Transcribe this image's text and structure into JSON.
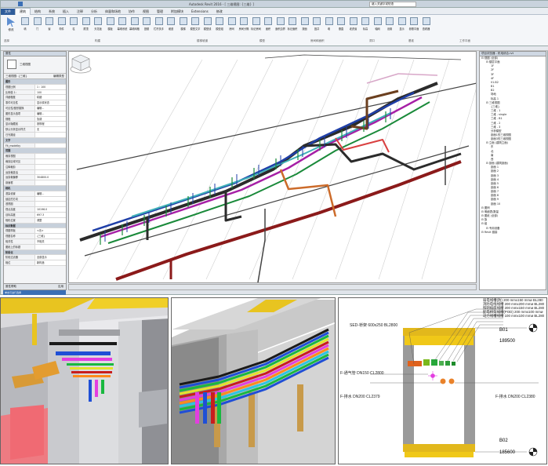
{
  "window": {
    "title": "Autodesk Revit 2016 - [ 三维视图: {三维} ]",
    "search_placeholder": "键入关键字或短语"
  },
  "ribbon": {
    "tabs": [
      "文件",
      "建筑",
      "结构",
      "系统",
      "插入",
      "注释",
      "分析",
      "体量和场地",
      "协作",
      "视图",
      "管理",
      "附加模块",
      "Extensions",
      "修改"
    ],
    "active_tab": "建筑",
    "modify_label": "修改",
    "buttons": [
      "墙",
      "门",
      "窗",
      "构件",
      "柱",
      "屋顶",
      "天花板",
      "楼板",
      "幕墙系统",
      "幕墙网格",
      "竖梃",
      "栏杆扶手",
      "坡道",
      "楼梯",
      "模型文字",
      "模型线",
      "模型组",
      "房间",
      "房间分隔",
      "标记房间",
      "面积",
      "面积边界",
      "标记面积",
      "按面",
      "竖井",
      "墙",
      "垂直",
      "老虎窗",
      "标高",
      "轴网",
      "设置",
      "显示",
      "参照平面",
      "查看器"
    ],
    "groups": [
      "选择",
      "构建",
      "楼梯坡道",
      "模型",
      "房间和面积",
      "洞口",
      "基准",
      "工作平面"
    ]
  },
  "properties": {
    "header": "属性",
    "type_name": "三维视图",
    "selector": "三维视图: {三维}",
    "edit_type": "编辑类型",
    "rows": [
      {
        "k": "图形",
        "v": "",
        "group": true
      },
      {
        "k": "视图比例",
        "v": "1 : 100"
      },
      {
        "k": "比例值 1:",
        "v": "100"
      },
      {
        "k": "详细程度",
        "v": "精细"
      },
      {
        "k": "零件可见性",
        "v": "显示原状态"
      },
      {
        "k": "可见性/图形替换",
        "v": "编辑..."
      },
      {
        "k": "图形显示选项",
        "v": "编辑..."
      },
      {
        "k": "规程",
        "v": "协调"
      },
      {
        "k": "显示隐藏线",
        "v": "按规程"
      },
      {
        "k": "默认分析显示样式",
        "v": "无"
      },
      {
        "k": "日光路径",
        "v": ""
      },
      {
        "k": "文字",
        "v": "",
        "group": true
      },
      {
        "k": "Fit_modelby",
        "v": ""
      },
      {
        "k": "范围",
        "v": "",
        "group": true
      },
      {
        "k": "裁剪视图",
        "v": ""
      },
      {
        "k": "裁剪区域可见",
        "v": ""
      },
      {
        "k": "注释裁剪",
        "v": ""
      },
      {
        "k": "远剪裁激活",
        "v": ""
      },
      {
        "k": "远剪裁偏移",
        "v": "304800.0"
      },
      {
        "k": "剖面框",
        "v": ""
      },
      {
        "k": "相机",
        "v": "",
        "group": true
      },
      {
        "k": "渲染设置",
        "v": "编辑..."
      },
      {
        "k": "锁定的方向",
        "v": ""
      },
      {
        "k": "透视图",
        "v": ""
      },
      {
        "k": "视点高度",
        "v": "10196.0"
      },
      {
        "k": "目标高度",
        "v": "697.3"
      },
      {
        "k": "相机位置",
        "v": "调整"
      },
      {
        "k": "标识数据",
        "v": "",
        "group": true
      },
      {
        "k": "视图样板",
        "v": "<无>"
      },
      {
        "k": "视图名称",
        "v": "{三维}"
      },
      {
        "k": "相关性",
        "v": "不相关"
      },
      {
        "k": "图纸上的标题",
        "v": ""
      },
      {
        "k": "阶段化",
        "v": "",
        "group": true
      },
      {
        "k": "阶段过滤器",
        "v": "全部显示"
      },
      {
        "k": "相位",
        "v": "新构造"
      }
    ],
    "help": "属性帮助",
    "apply": "应用"
  },
  "status": "单击可进行选择",
  "browser": {
    "header": "项目浏览器 - 机电综合.rvt",
    "items": [
      {
        "t": "视图 (全部)",
        "d": 0
      },
      {
        "t": "楼层平面",
        "d": 1
      },
      {
        "t": "1F",
        "d": 2
      },
      {
        "t": "2F",
        "d": 2
      },
      {
        "t": "3F",
        "d": 2
      },
      {
        "t": "4F",
        "d": 2
      },
      {
        "t": "01-B2",
        "d": 2
      },
      {
        "t": "B1",
        "d": 2
      },
      {
        "t": "B2",
        "d": 2
      },
      {
        "t": "场地",
        "d": 2
      },
      {
        "t": "标高 1",
        "d": 2
      },
      {
        "t": "三维视图",
        "d": 1
      },
      {
        "t": "{三维}",
        "d": 2
      },
      {
        "t": "三维 - 1",
        "d": 2
      },
      {
        "t": "三维 - single",
        "d": 2
      },
      {
        "t": "三维 - B1",
        "d": 2
      },
      {
        "t": "三维 - 2",
        "d": 2
      },
      {
        "t": "三维 - 3",
        "d": 2
      },
      {
        "t": "分析模型",
        "d": 2
      },
      {
        "t": "剖面1的三维视图",
        "d": 2
      },
      {
        "t": "剖面3的三维视图",
        "d": 2
      },
      {
        "t": "立面 (建筑立面)",
        "d": 1
      },
      {
        "t": "东",
        "d": 2
      },
      {
        "t": "北",
        "d": 2
      },
      {
        "t": "南",
        "d": 2
      },
      {
        "t": "西",
        "d": 2
      },
      {
        "t": "剖面 (建筑剖面)",
        "d": 1
      },
      {
        "t": "剖面 1",
        "d": 2
      },
      {
        "t": "剖面 2",
        "d": 2
      },
      {
        "t": "剖面 3",
        "d": 2
      },
      {
        "t": "剖面 4",
        "d": 2
      },
      {
        "t": "剖面 5",
        "d": 2
      },
      {
        "t": "剖面 6",
        "d": 2
      },
      {
        "t": "剖面 7",
        "d": 2
      },
      {
        "t": "剖面 8",
        "d": 2
      },
      {
        "t": "剖面 9",
        "d": 2
      },
      {
        "t": "剖面 10",
        "d": 2
      },
      {
        "t": "图例",
        "d": 0
      },
      {
        "t": "明细表/数量",
        "d": 0
      },
      {
        "t": "图纸 (全部)",
        "d": 0
      },
      {
        "t": "族",
        "d": 0
      },
      {
        "t": "组",
        "d": 0
      },
      {
        "t": "专用设备",
        "d": 1
      },
      {
        "t": "Revit 链接",
        "d": 0
      }
    ]
  },
  "section_labels": [
    "SED-桥架 600x250 BL2800",
    "弱电线槽(防) 200 mmx150 mmø BL280",
    "消防电线线槽 200 mmx200 mmø BL280",
    "照明插座线槽 200 mmx150 mmø BL280",
    "配电桥架线槽(POD) 200 mmx100 mmø",
    "动力线槽线槽 100 mmx100 mmø BL280",
    "F-通气管 DN150 CL2800",
    "F-排水 DN200 CL2379",
    "F-排水 DN200 CL2380"
  ],
  "levels": [
    {
      "name": "B01",
      "elev": "189500"
    },
    {
      "name": "B02",
      "elev": "185600"
    }
  ],
  "colors": {
    "accent": "#2e5c9a",
    "panel_bg": "#f3f4f6"
  }
}
